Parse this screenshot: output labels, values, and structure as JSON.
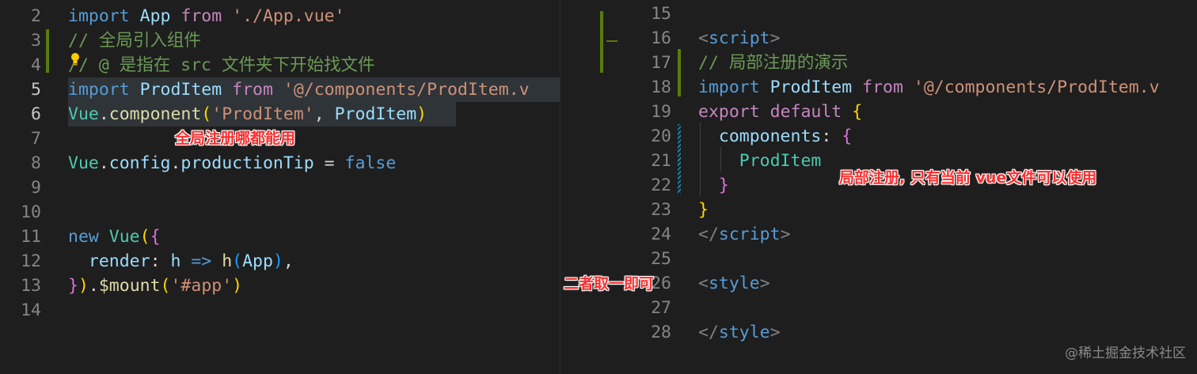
{
  "left_editor": {
    "lines": [
      {
        "n": "2",
        "tokens": [
          [
            "kw",
            "import"
          ],
          [
            "plain",
            " "
          ],
          [
            "id",
            "App"
          ],
          [
            "plain",
            " "
          ],
          [
            "ctl",
            "from"
          ],
          [
            "plain",
            " "
          ],
          [
            "str",
            "'./App.vue'"
          ]
        ]
      },
      {
        "n": "3",
        "tokens": [
          [
            "cm",
            "// 全局引入组件"
          ]
        ]
      },
      {
        "n": "4",
        "tokens": [
          [
            "cm",
            "// @ 是指在 src 文件夹下开始找文件"
          ]
        ]
      },
      {
        "n": "5",
        "tokens": [
          [
            "kw",
            "import"
          ],
          [
            "plain",
            " "
          ],
          [
            "id",
            "ProdItem"
          ],
          [
            "plain",
            " "
          ],
          [
            "ctl",
            "from"
          ],
          [
            "plain",
            " "
          ],
          [
            "str",
            "'@/components/ProdItem.v"
          ]
        ]
      },
      {
        "n": "6",
        "tokens": [
          [
            "cls",
            "Vue"
          ],
          [
            "plain",
            "."
          ],
          [
            "fn",
            "component"
          ],
          [
            "br1",
            "("
          ],
          [
            "str",
            "'ProdItem'"
          ],
          [
            "plain",
            ", "
          ],
          [
            "id",
            "ProdItem"
          ],
          [
            "br1",
            ")"
          ]
        ]
      },
      {
        "n": "7",
        "tokens": []
      },
      {
        "n": "8",
        "tokens": [
          [
            "cls",
            "Vue"
          ],
          [
            "plain",
            "."
          ],
          [
            "id",
            "config"
          ],
          [
            "plain",
            "."
          ],
          [
            "id",
            "productionTip"
          ],
          [
            "plain",
            " = "
          ],
          [
            "const",
            "false"
          ]
        ]
      },
      {
        "n": "9",
        "tokens": []
      },
      {
        "n": "10",
        "tokens": []
      },
      {
        "n": "11",
        "tokens": [
          [
            "kw",
            "new"
          ],
          [
            "plain",
            " "
          ],
          [
            "cls",
            "Vue"
          ],
          [
            "br1",
            "("
          ],
          [
            "br2",
            "{"
          ]
        ]
      },
      {
        "n": "12",
        "tokens": [
          [
            "plain",
            "  "
          ],
          [
            "id",
            "render"
          ],
          [
            "plain",
            ": "
          ],
          [
            "id",
            "h"
          ],
          [
            "plain",
            " "
          ],
          [
            "kw",
            "=>"
          ],
          [
            "plain",
            " "
          ],
          [
            "fn",
            "h"
          ],
          [
            "br3",
            "("
          ],
          [
            "id",
            "App"
          ],
          [
            "br3",
            ")"
          ],
          [
            "plain",
            ","
          ]
        ]
      },
      {
        "n": "13",
        "tokens": [
          [
            "br2",
            "}"
          ],
          [
            "br1",
            ")"
          ],
          [
            "plain",
            "."
          ],
          [
            "fn",
            "$mount"
          ],
          [
            "br1",
            "("
          ],
          [
            "str",
            "'#app'"
          ],
          [
            "br1",
            ")"
          ]
        ]
      },
      {
        "n": "14",
        "tokens": []
      }
    ]
  },
  "right_editor": {
    "lines": [
      {
        "n": "15",
        "tokens": []
      },
      {
        "n": "16",
        "tokens": [
          [
            "punc",
            "<"
          ],
          [
            "tag",
            "script"
          ],
          [
            "punc",
            ">"
          ]
        ]
      },
      {
        "n": "17",
        "tokens": [
          [
            "cm",
            "// 局部注册的演示"
          ]
        ]
      },
      {
        "n": "18",
        "tokens": [
          [
            "kw",
            "import"
          ],
          [
            "plain",
            " "
          ],
          [
            "id",
            "ProdItem"
          ],
          [
            "plain",
            " "
          ],
          [
            "ctl",
            "from"
          ],
          [
            "plain",
            " "
          ],
          [
            "str",
            "'@/components/ProdItem.v"
          ]
        ]
      },
      {
        "n": "19",
        "tokens": [
          [
            "ctl",
            "export"
          ],
          [
            "plain",
            " "
          ],
          [
            "ctl",
            "default"
          ],
          [
            "plain",
            " "
          ],
          [
            "br1",
            "{"
          ]
        ]
      },
      {
        "n": "20",
        "tokens": [
          [
            "plain",
            "  "
          ],
          [
            "id",
            "components"
          ],
          [
            "plain",
            ": "
          ],
          [
            "br2",
            "{"
          ]
        ]
      },
      {
        "n": "21",
        "tokens": [
          [
            "plain",
            "    "
          ],
          [
            "cls",
            "ProdItem"
          ]
        ]
      },
      {
        "n": "22",
        "tokens": [
          [
            "plain",
            "  "
          ],
          [
            "br2",
            "}"
          ]
        ]
      },
      {
        "n": "23",
        "tokens": [
          [
            "br1",
            "}"
          ]
        ]
      },
      {
        "n": "24",
        "tokens": [
          [
            "punc",
            "</"
          ],
          [
            "tag",
            "script"
          ],
          [
            "punc",
            ">"
          ]
        ]
      },
      {
        "n": "25",
        "tokens": []
      },
      {
        "n": "26",
        "tokens": [
          [
            "punc",
            "<"
          ],
          [
            "tag",
            "style"
          ],
          [
            "punc",
            ">"
          ]
        ]
      },
      {
        "n": "27",
        "tokens": []
      },
      {
        "n": "28",
        "tokens": [
          [
            "punc",
            "</"
          ],
          [
            "tag",
            "style"
          ],
          [
            "punc",
            ">"
          ]
        ]
      }
    ]
  },
  "annotations": {
    "global": "全局注册哪都能用",
    "local": "局部注册, 只有当前 vue文件可以使用",
    "either": "二者取一即可"
  },
  "watermark": "@稀土掘金技术社区",
  "colors": {
    "background": "#1e1e1e",
    "annotation": "#ff2d2d",
    "gutter_modified": "#587c0c",
    "gutter_changed": "#1b81a8"
  }
}
